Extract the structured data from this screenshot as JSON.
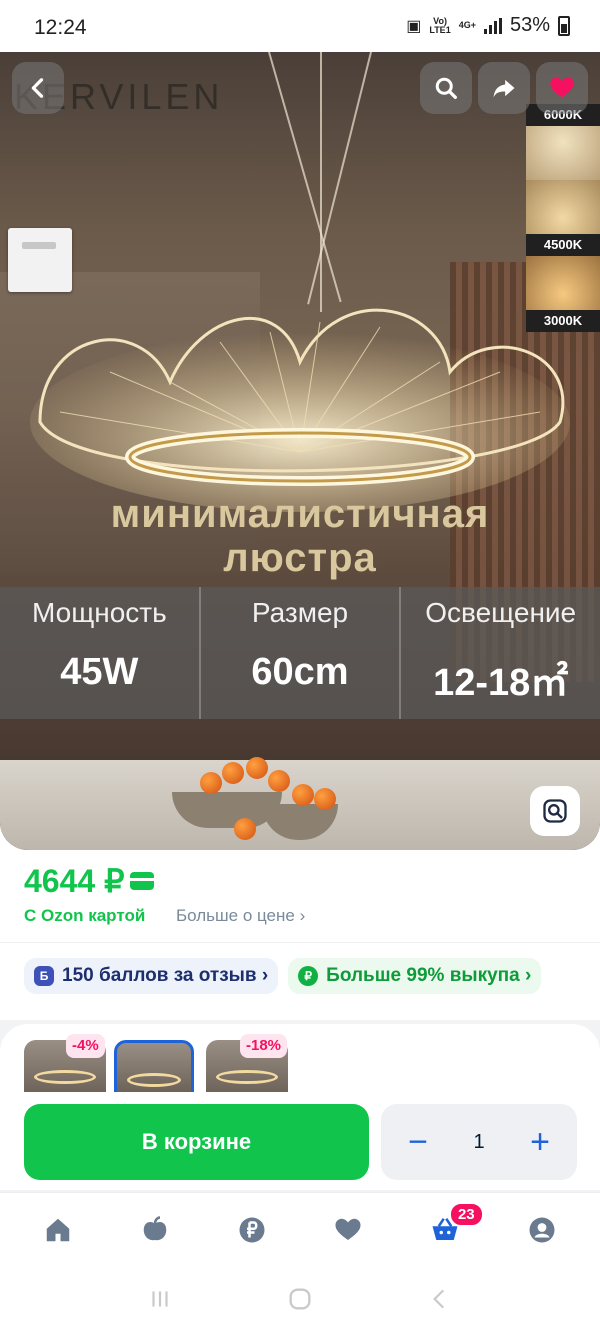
{
  "status_bar": {
    "time": "12:24",
    "network_top": "Vo)",
    "network_bottom": "LTE1",
    "net2_top": "4G+",
    "battery": "53%"
  },
  "hero": {
    "brand": "KERVILEN",
    "color_temps": [
      "6000K",
      "4500K",
      "3000K"
    ],
    "title_line1": "минималистичная",
    "title_line2": "люстра",
    "specs": [
      {
        "label": "Мощность",
        "value": "45W"
      },
      {
        "label": "Размер",
        "value": "60cm"
      },
      {
        "label": "Освещение",
        "value": "12-18㎡"
      }
    ],
    "icons": {
      "back": "back-arrow-icon",
      "search": "search-icon",
      "share": "share-icon",
      "favorite": "heart-icon",
      "lens": "image-search-icon"
    }
  },
  "price": {
    "value": "4644 ₽",
    "ozon_card": "С Ozon картой",
    "more": "Больше о цене ›"
  },
  "chips": [
    {
      "icon_text": "Б",
      "label": "150 баллов за отзыв ›"
    },
    {
      "icon_text": "Ф",
      "label": "Больше 99% выкупа ›"
    }
  ],
  "variants": [
    {
      "badge": "-4%"
    },
    {
      "badge": ""
    },
    {
      "badge": "-18%"
    }
  ],
  "buy": {
    "cart_label": "В корзине",
    "minus": "−",
    "qty": "1",
    "plus": "+"
  },
  "tabbar": {
    "cart_count": "23"
  },
  "colors": {
    "accent_green": "#10c44c",
    "accent_blue": "#1f63d9",
    "accent_pink": "#f5115f"
  }
}
